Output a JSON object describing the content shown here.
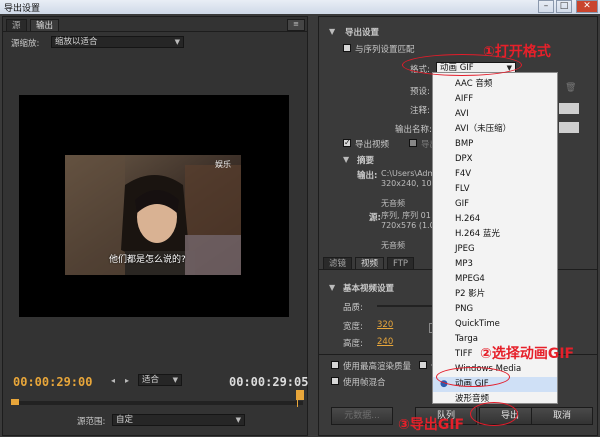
{
  "window": {
    "title": "导出设置",
    "minimize": "–",
    "maximize": "□",
    "close": "✕"
  },
  "left": {
    "tabs": [
      "源",
      "输出"
    ],
    "source_scale_label": "源缩放:",
    "source_scale_value": "缩放以适合",
    "video": {
      "channel_logo": "娱乐",
      "subtitle": "他们都是怎么说的?"
    },
    "timecode_current": "00:00:29:00",
    "zoom_value": "适合",
    "timecode_end": "00:00:29:05",
    "source_range_label": "源范围:",
    "source_range_value": "自定"
  },
  "export": {
    "section_title": "导出设置",
    "match_sequence_label": "与序列设置匹配",
    "format_label": "格式:",
    "format_value": "动画 GIF",
    "preset_label": "预设:",
    "comment_label": "注释:",
    "output_name_label": "输出名称:",
    "export_video_label": "导出视频",
    "export_audio_label": "导出音频",
    "summary_title": "摘要",
    "output_label": "输出:",
    "output_lines": [
      "C:\\Users\\Admini...",
      "320x240, 10 fps, ...",
      "",
      "无音频"
    ],
    "source_label": "源:",
    "source_lines": [
      "序列, 序列 01",
      "720x576 (1.0940)...",
      "",
      "无音频"
    ]
  },
  "format_menu": {
    "items": [
      "AAC 音频",
      "AIFF",
      "AVI",
      "AVI（未压缩）",
      "BMP",
      "DPX",
      "F4V",
      "FLV",
      "GIF",
      "H.264",
      "H.264 蓝光",
      "JPEG",
      "MP3",
      "MPEG4",
      "P2 影片",
      "PNG",
      "QuickTime",
      "Targa",
      "TIFF",
      "Windows Media",
      "动画 GIF",
      "波形音频"
    ],
    "selected_index": 20
  },
  "lower_tabs": [
    "滤镜",
    "视频",
    "FTP"
  ],
  "basic_video": {
    "title": "基本视频设置",
    "quality_label": "品质:",
    "width_label": "宽度:",
    "width_value": "320",
    "height_label": "高度:",
    "height_value": "240"
  },
  "bottom_options": {
    "max_render_label": "使用最高渲染质量",
    "use_preview_label": "使",
    "frame_blend_label": "使用帧混合"
  },
  "buttons": {
    "metadata": "元数据...",
    "queue": "队列",
    "export": "导出",
    "cancel": "取消"
  },
  "annotations": {
    "step1": "①打开格式",
    "step2": "②选择动画GIF",
    "step3": "③导出GIF"
  }
}
